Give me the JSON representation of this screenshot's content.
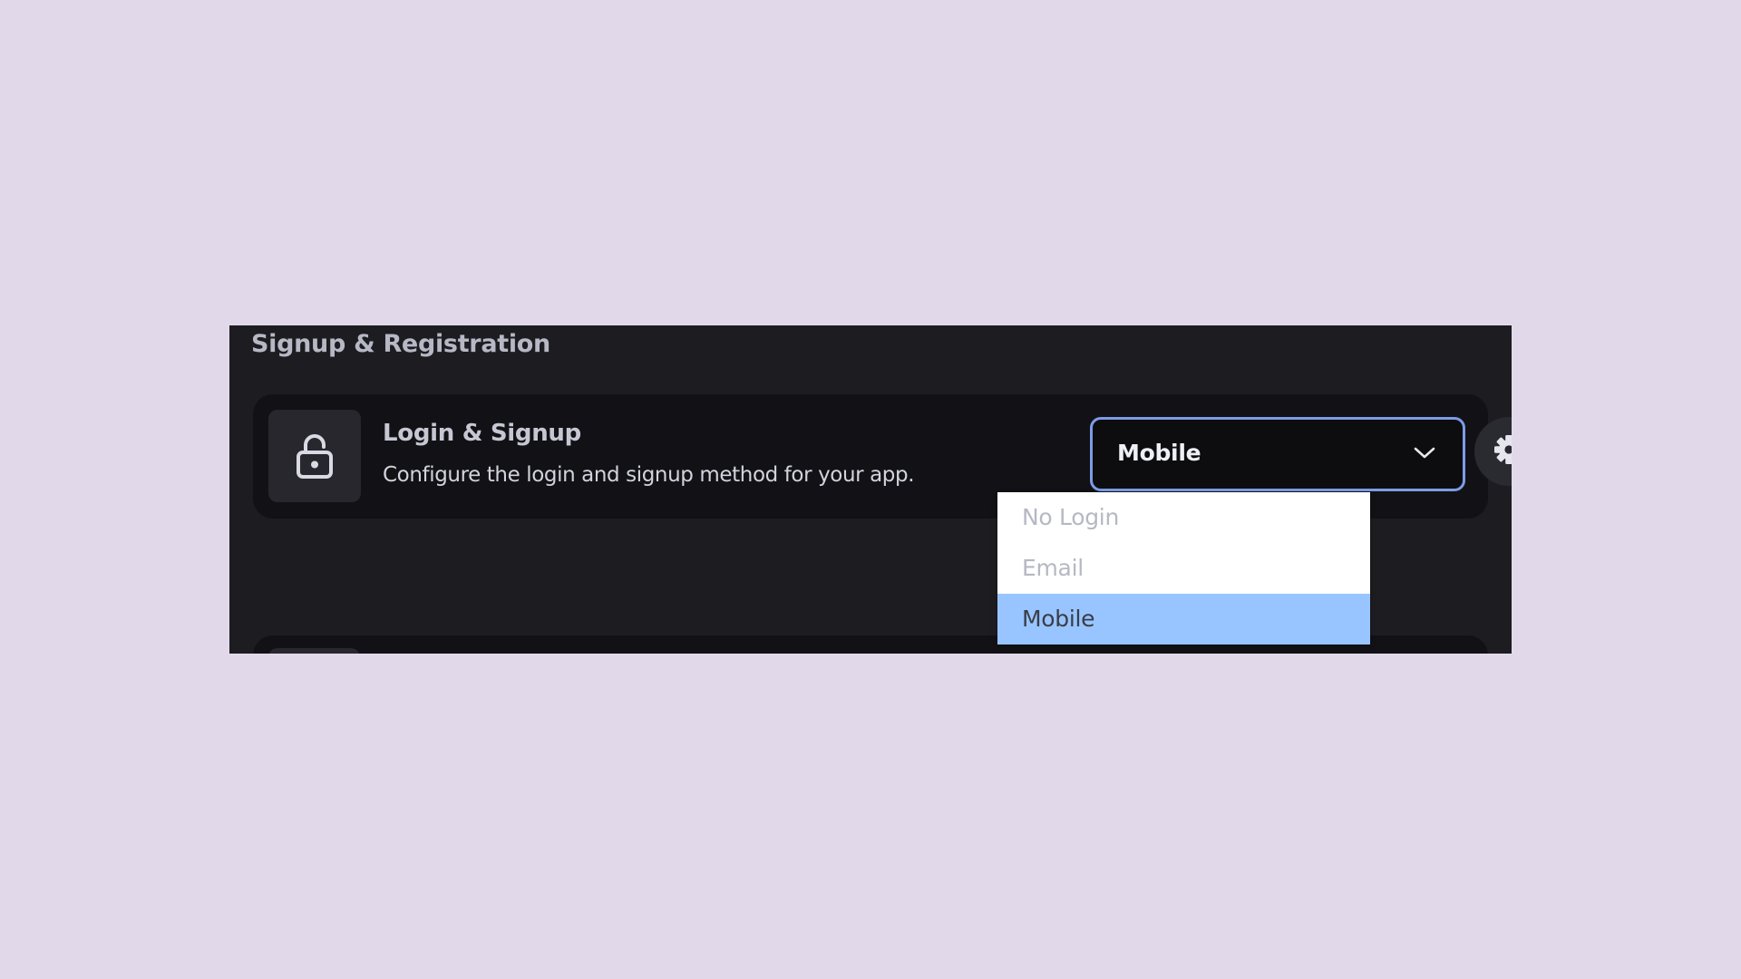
{
  "section": {
    "title": "Signup & Registration"
  },
  "login_card": {
    "icon": "lock-open-icon",
    "title": "Login & Signup",
    "description": "Configure the login and signup method for your app.",
    "select": {
      "value": "Mobile",
      "options": [
        "No Login",
        "Email",
        "Mobile"
      ],
      "selected_index": 2
    },
    "settings_icon": "gear-icon"
  },
  "colors": {
    "background": "#e1d9ea",
    "panel": "#1c1c21",
    "card": "#121216",
    "focus_border": "#7d9ce6",
    "selected_option": "#98c5ff"
  }
}
